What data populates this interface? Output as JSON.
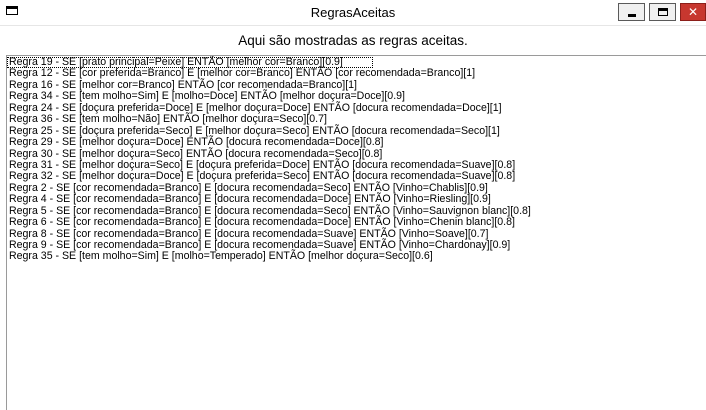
{
  "window": {
    "title": "RegrasAceitas",
    "buttons": {
      "minimize": "minimize-icon",
      "maximize": "maximize-icon",
      "close": "close-icon"
    },
    "close_color": "#c7372f"
  },
  "header": {
    "text": "Aqui são mostradas as regras aceitas."
  },
  "rules": [
    "Regra 19 - SE [prato principal=Peixe] ENTÃO [melhor cor=Branco][0.9]",
    "Regra 12 - SE [cor preferida=Branco] E [melhor cor=Branco] ENTÃO [cor recomendada=Branco][1]",
    "Regra 16 - SE [melhor cor=Branco] ENTÃO [cor recomendada=Branco][1]",
    "Regra 34 - SE [tem molho=Sim] E [molho=Doce] ENTÃO [melhor doçura=Doce][0.9]",
    "Regra 24 - SE [doçura preferida=Doce] E [melhor doçura=Doce] ENTÃO [docura recomendada=Doce][1]",
    "Regra 36 - SE [tem molho=Não] ENTÃO [melhor doçura=Seco][0.7]",
    "Regra 25 - SE [doçura preferida=Seco] E [melhor doçura=Seco] ENTÃO [docura recomendada=Seco][1]",
    "Regra 29 - SE [melhor doçura=Doce] ENTÃO [docura recomendada=Doce][0.8]",
    "Regra 30 - SE [melhor doçura=Seco] ENTÃO [docura recomendada=Seco][0.8]",
    "Regra 31 - SE [melhor doçura=Seco] E [doçura preferida=Doce] ENTÃO [docura recomendada=Suave][0.8]",
    "Regra 32 - SE [melhor doçura=Doce] E [doçura preferida=Seco] ENTÃO [docura recomendada=Suave][0.8]",
    "Regra 2 - SE [cor recomendada=Branco] E [docura recomendada=Seco] ENTÃO [Vinho=Chablis][0.9]",
    "Regra 4 - SE [cor recomendada=Branco] E [docura recomendada=Doce] ENTÃO [Vinho=Riesling][0.9]",
    "Regra 5 - SE [cor recomendada=Branco] E [docura recomendada=Seco] ENTÃO [Vinho=Sauvignon blanc][0.8]",
    "Regra 6 - SE [cor recomendada=Branco] E [docura recomendada=Doce] ENTÃO [Vinho=Chenin blanc][0.8]",
    "Regra 8 - SE [cor recomendada=Branco] E [docura recomendada=Suave] ENTÃO [Vinho=Soave][0.7]",
    "Regra 9 - SE [cor recomendada=Branco] E [docura recomendada=Suave] ENTÃO [Vinho=Chardonay][0.9]",
    "Regra 35 - SE [tem molho=Sim] E [molho=Temperado] ENTÃO [melhor doçura=Seco][0.6]"
  ]
}
